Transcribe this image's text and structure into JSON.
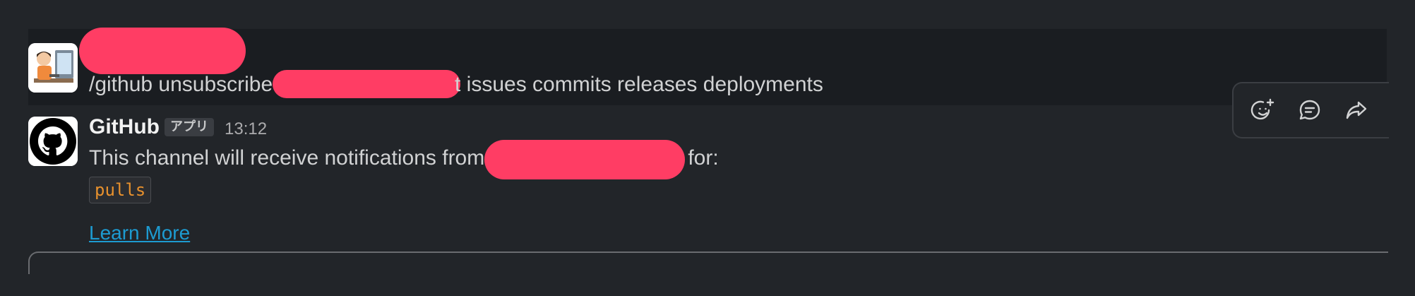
{
  "messages": {
    "user_message": {
      "command_prefix": "/github unsubscribe ",
      "command_suffix": "t issues commits releases deployments"
    },
    "bot_message": {
      "sender": "GitHub",
      "app_badge": "アプリ",
      "time": "13:12",
      "text_prefix": "This channel will receive notifications from ",
      "text_suffix": " for:",
      "code": "pulls",
      "link": "Learn More"
    }
  },
  "toolbar": {
    "icons": [
      "add-reaction-icon",
      "reply-in-thread-icon",
      "share-icon"
    ]
  },
  "colors": {
    "background": "#222529",
    "hover_background": "#1a1d21",
    "link": "#1d9bd1",
    "code": "#e8912d",
    "redaction": "#ff3d64"
  }
}
